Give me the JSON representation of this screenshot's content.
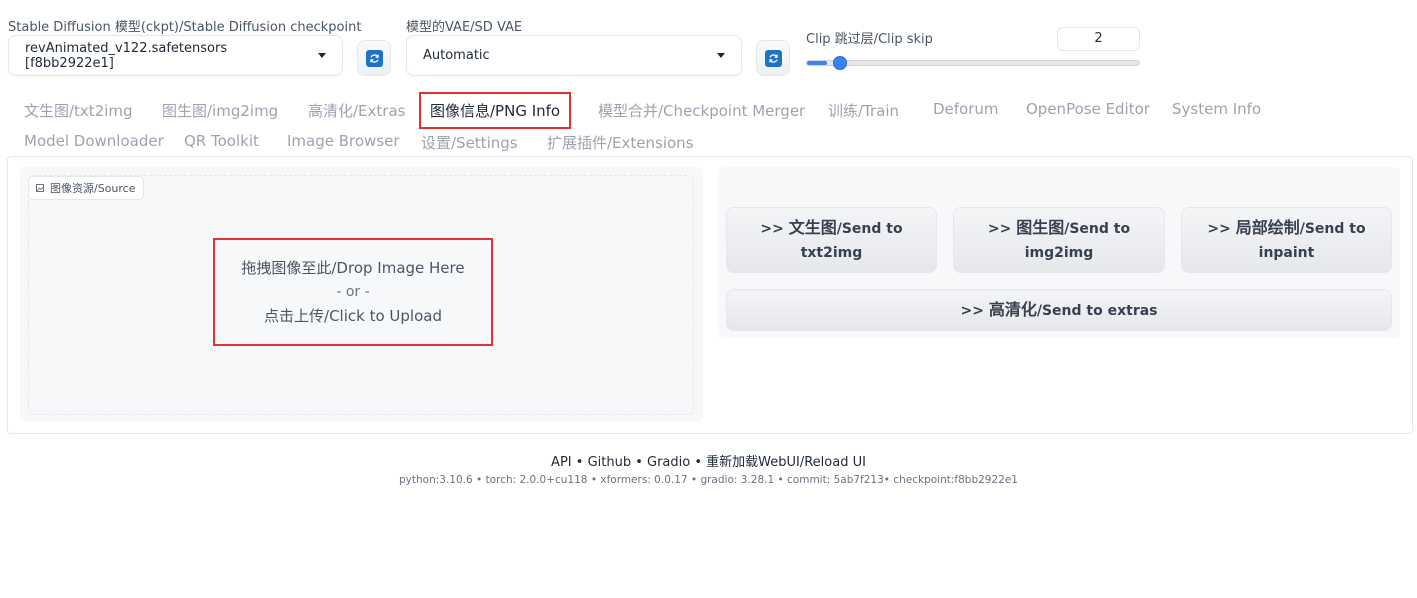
{
  "settings": {
    "checkpoint_label": "Stable Diffusion 模型(ckpt)/Stable Diffusion checkpoint",
    "checkpoint_value": "revAnimated_v122.safetensors [f8bb2922e1]",
    "vae_label": "模型的VAE/SD VAE",
    "vae_value": "Automatic",
    "clip_label": "Clip 跳过层/Clip skip",
    "clip_value": "2",
    "clip_fraction": 0.06,
    "refresh_icon": "refresh-icon"
  },
  "tabs": [
    {
      "label": "文生图/txt2img"
    },
    {
      "label": "图生图/img2img"
    },
    {
      "label": "高清化/Extras"
    },
    {
      "label": "图像信息/PNG Info",
      "selected": true
    },
    {
      "label": "模型合并/Checkpoint Merger"
    },
    {
      "label": "训练/Train"
    },
    {
      "label": "Deforum"
    },
    {
      "label": "OpenPose Editor"
    },
    {
      "label": "System Info"
    },
    {
      "label": "Model Downloader"
    },
    {
      "label": "QR Toolkit"
    },
    {
      "label": "Image Browser"
    },
    {
      "label": "设置/Settings"
    },
    {
      "label": "扩展插件/Extensions"
    }
  ],
  "source": {
    "label": "图像资源/Source",
    "icon": "image-icon",
    "drop_text": "拖拽图像至此/Drop Image Here",
    "or_text": "- or -",
    "upload_text": "点击上传/Click to Upload"
  },
  "send": {
    "txt2img_prefix": ">> ",
    "txt2img_bold": "文生图",
    "txt2img_rest": "/Send to",
    "txt2img_line2": "txt2img",
    "img2img_prefix": ">> ",
    "img2img_bold": "图生图",
    "img2img_rest": "/Send to",
    "img2img_line2": "img2img",
    "inpaint_prefix": ">> ",
    "inpaint_bold": "局部绘制",
    "inpaint_rest": "/Send to",
    "inpaint_line2": "inpaint",
    "extras_prefix": ">> ",
    "extras_bold": "高清化",
    "extras_rest": "/Send to extras"
  },
  "footer": {
    "api": "API",
    "github": "Github",
    "gradio": "Gradio",
    "reload": "重新加载WebUI/Reload UI",
    "sep": " • ",
    "python": "python:3.10.6",
    "torch": "torch: 2.0.0+cu118",
    "xformers": "xformers: 0.0.17",
    "gradio_version": "gradio: 3.28.1",
    "commit": "commit: 5ab7f213•",
    "checkpoint": "checkpoint:f8bb2922e1"
  },
  "colors": {
    "accent": "#3b82f6",
    "highlight": "#e03131",
    "refresh": "#1e73c8"
  }
}
